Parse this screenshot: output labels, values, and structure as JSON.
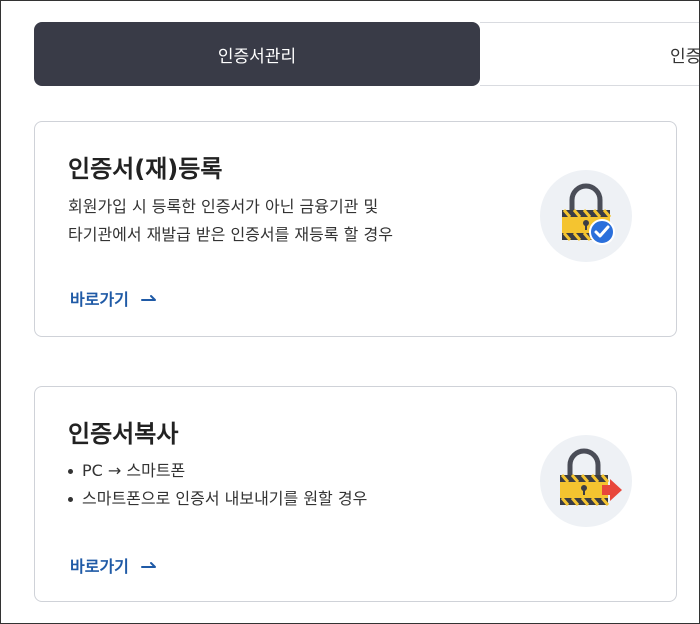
{
  "tabs": [
    {
      "label": "인증서관리",
      "active": true
    },
    {
      "label": "인증",
      "active": false
    }
  ],
  "cards": [
    {
      "title": "인증서(재)등록",
      "description": [
        "회원가입 시 등록한 인증서가 아닌 금융기관 및",
        "타기관에서 재발급 받은 인증서를 재등록 할 경우"
      ],
      "link_label": "바로가기",
      "icon": "lock-check-icon"
    },
    {
      "title": "인증서복사",
      "bullets": [
        "PC → 스마트폰",
        "스마트폰으로 인증서 내보내기를 원할 경우"
      ],
      "link_label": "바로가기",
      "icon": "lock-arrow-icon"
    }
  ],
  "colors": {
    "active_tab": "#393b47",
    "link": "#1f5aa6",
    "lock_yellow": "#f4c430",
    "check_blue": "#2a6fdb",
    "arrow_red": "#e8473b"
  }
}
